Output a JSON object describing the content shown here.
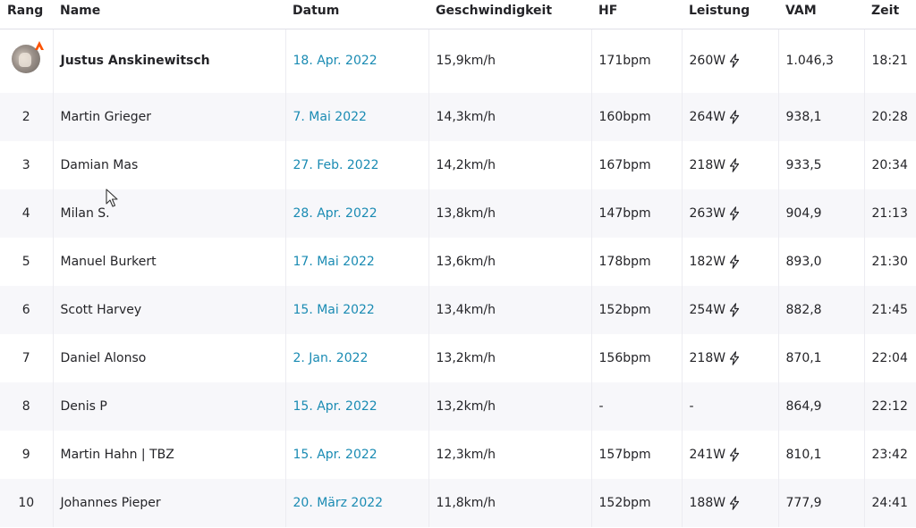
{
  "headers": {
    "rank": "Rang",
    "name": "Name",
    "date": "Datum",
    "speed": "Geschwindigkeit",
    "hr": "HF",
    "power": "Leistung",
    "vam": "VAM",
    "time": "Zeit"
  },
  "rows": [
    {
      "rank": "",
      "name": "Justus Anskinewitsch",
      "date": "18. Apr. 2022",
      "speed": "15,9km/h",
      "hr": "171bpm",
      "power": "260W",
      "vam": "1.046,3",
      "time": "18:21"
    },
    {
      "rank": "2",
      "name": "Martin Grieger",
      "date": "7. Mai 2022",
      "speed": "14,3km/h",
      "hr": "160bpm",
      "power": "264W",
      "vam": "938,1",
      "time": "20:28"
    },
    {
      "rank": "3",
      "name": "Damian Mas",
      "date": "27. Feb. 2022",
      "speed": "14,2km/h",
      "hr": "167bpm",
      "power": "218W",
      "vam": "933,5",
      "time": "20:34"
    },
    {
      "rank": "4",
      "name": "Milan S.",
      "date": "28. Apr. 2022",
      "speed": "13,8km/h",
      "hr": "147bpm",
      "power": "263W",
      "vam": "904,9",
      "time": "21:13"
    },
    {
      "rank": "5",
      "name": "Manuel Burkert",
      "date": "17. Mai 2022",
      "speed": "13,6km/h",
      "hr": "178bpm",
      "power": "182W",
      "vam": "893,0",
      "time": "21:30"
    },
    {
      "rank": "6",
      "name": "Scott Harvey",
      "date": "15. Mai 2022",
      "speed": "13,4km/h",
      "hr": "152bpm",
      "power": "254W",
      "vam": "882,8",
      "time": "21:45"
    },
    {
      "rank": "7",
      "name": "Daniel Alonso",
      "date": "2. Jan. 2022",
      "speed": "13,2km/h",
      "hr": "156bpm",
      "power": "218W",
      "vam": "870,1",
      "time": "22:04"
    },
    {
      "rank": "8",
      "name": "Denis P",
      "date": "15. Apr. 2022",
      "speed": "13,2km/h",
      "hr": "-",
      "power": "-",
      "vam": "864,9",
      "time": "22:12"
    },
    {
      "rank": "9",
      "name": "Martin Hahn | TBZ",
      "date": "15. Apr. 2022",
      "speed": "12,3km/h",
      "hr": "157bpm",
      "power": "241W",
      "vam": "810,1",
      "time": "23:42"
    },
    {
      "rank": "10",
      "name": "Johannes Pieper",
      "date": "20. März 2022",
      "speed": "11,8km/h",
      "hr": "152bpm",
      "power": "188W",
      "vam": "777,9",
      "time": "24:41"
    }
  ],
  "icons": {
    "power": "lightning-bolt-icon",
    "avatar_badge": "orange-chevron-badge-icon",
    "cursor": "mouse-pointer-icon"
  },
  "colors": {
    "link": "#1a8bb3",
    "badge": "#fc5200",
    "row_alt": "#f7f7fa"
  }
}
